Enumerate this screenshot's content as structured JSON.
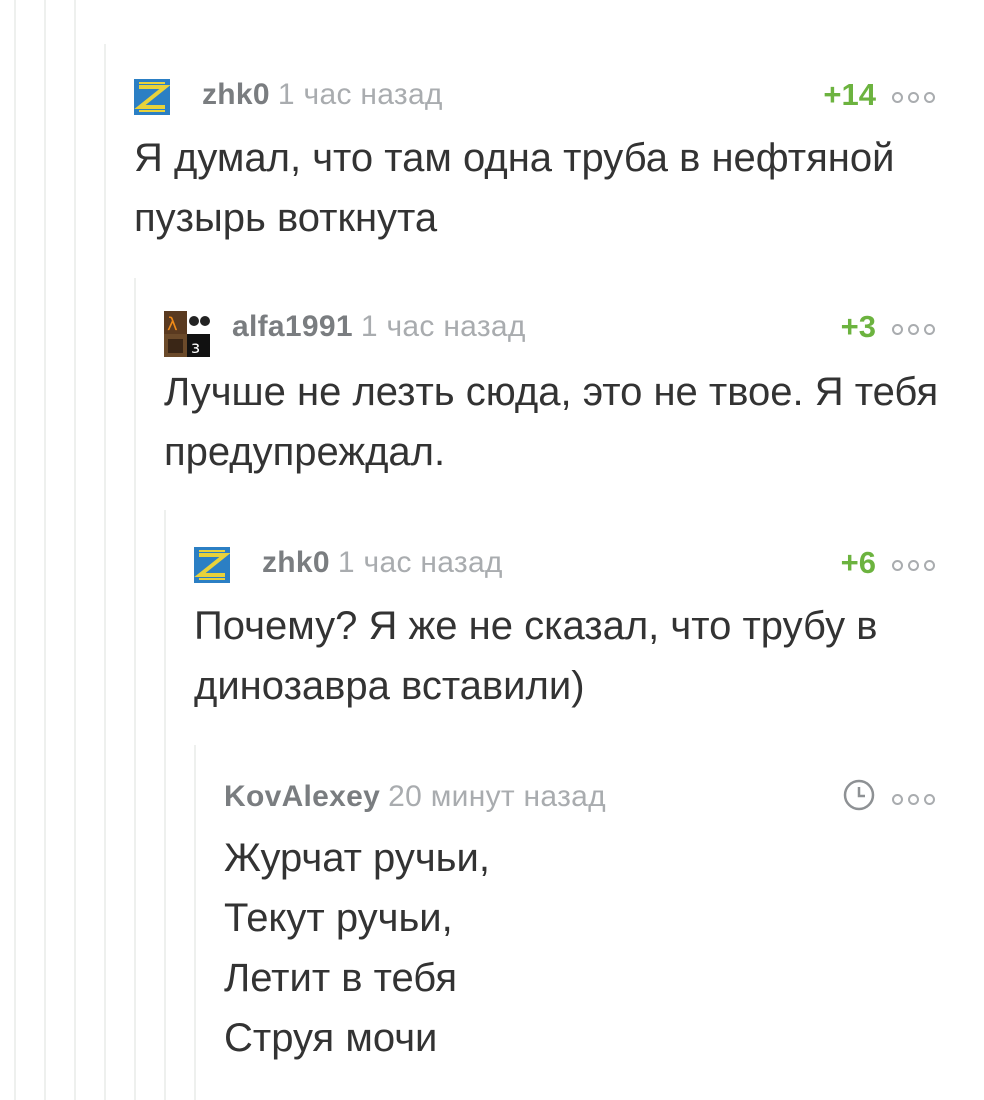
{
  "comments": [
    {
      "author": "zhk0",
      "time": "1 час назад",
      "rating": "+14",
      "text": "Я думал, что там одна труба в нефтяной пузырь воткнута",
      "avatar_icon": "zhk0-avatar-icon"
    },
    {
      "author": "alfa1991",
      "time": "1 час назад",
      "rating": "+3",
      "text": "Лучше не лезть сюда, это не твое. Я тебя предупреждал.",
      "avatar_icon": "alfa1991-avatar-icon"
    },
    {
      "author": "zhk0",
      "time": "1 час назад",
      "rating": "+6",
      "text": "Почему? Я же не сказал, что трубу в динозавра вставили)",
      "avatar_icon": "zhk0-avatar-icon"
    },
    {
      "author": "KovAlexey",
      "time": "20 минут назад",
      "rating_icon": "clock-icon",
      "text": "Журчат ручьи,\nТекут ручьи,\nЛетит в тебя\nСтруя мочи"
    }
  ],
  "colors": {
    "rating_positive": "#6cb33f",
    "author": "#7a7d80",
    "timestamp": "#a9acaf",
    "thread_line": "#eef0ee",
    "avatar_zhk0_bg": "#2b7fc4",
    "avatar_zhk0_fg": "#e8d23a"
  }
}
